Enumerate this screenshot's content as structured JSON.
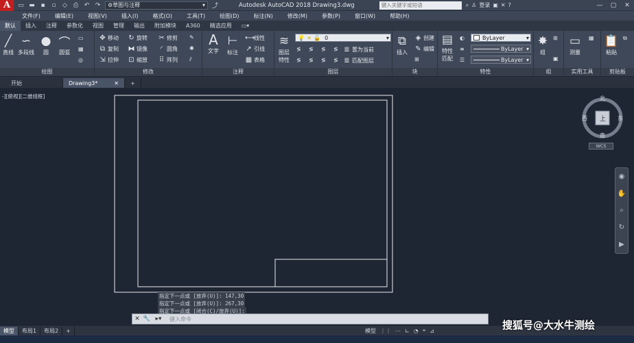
{
  "app": {
    "logo": "A",
    "workspace": "草图与注释",
    "title": "Autodesk AutoCAD 2018    Drawing3.dwg",
    "search_placeholder": "键入关键字或短语",
    "login": "登录"
  },
  "menu": [
    "文件(F)",
    "编辑(E)",
    "视图(V)",
    "插入(I)",
    "格式(O)",
    "工具(T)",
    "绘图(D)",
    "标注(N)",
    "修改(M)",
    "参数(P)",
    "窗口(W)",
    "帮助(H)"
  ],
  "ribbon_tabs": [
    "默认",
    "插入",
    "注释",
    "参数化",
    "视图",
    "管理",
    "输出",
    "附加模块",
    "A360",
    "精选应用"
  ],
  "ribbon": {
    "draw": {
      "title": "绘图",
      "line": "直线",
      "polyline": "多段线",
      "circle": "圆",
      "arc": "圆弧"
    },
    "modify": {
      "title": "修改",
      "move": "移动",
      "rotate": "旋转",
      "trim": "修剪",
      "copy": "复制",
      "mirror": "镜像",
      "fillet": "圆角",
      "stretch": "拉伸",
      "scale": "缩放",
      "array": "阵列"
    },
    "annotation": {
      "title": "注释",
      "text": "文字",
      "dimension": "标注",
      "linear": "线性",
      "leader": "引线",
      "table": "表格"
    },
    "layers": {
      "title": "图层",
      "props_line1": "图层",
      "props_line2": "特性",
      "layer_value": "0",
      "make_current": "置为当前",
      "match": "匹配图层"
    },
    "block": {
      "title": "块",
      "insert": "插入",
      "create": "创建",
      "edit": "编辑"
    },
    "properties": {
      "title": "特性",
      "match_line1": "特性",
      "match_line2": "匹配",
      "color": "ByLayer",
      "linetype": "ByLayer",
      "lineweight": "ByLayer"
    },
    "groups": {
      "title": "组",
      "group": "组"
    },
    "utilities": {
      "title": "实用工具",
      "measure": "测量"
    },
    "clipboard": {
      "title": "剪贴板",
      "paste": "粘贴"
    }
  },
  "doc_tabs": [
    "开始",
    "Drawing3*"
  ],
  "viewport_label": "-][俯视][二维线框]",
  "viewcube": {
    "north": "北",
    "south": "南",
    "east": "东",
    "west": "西",
    "top": "上",
    "wcs": "WCS"
  },
  "command_history": [
    "指定下一点或 [放弃(U)]: 147,30",
    "指定下一点或 [放弃(U)]: 267,30",
    "指定下一点或 [闭合(C)/放弃(U)]:"
  ],
  "command_placeholder": "键入命令",
  "layout_tabs": [
    "模型",
    "布局1",
    "布局2"
  ],
  "status": {
    "model": "模型"
  },
  "watermark": "搜狐号@大水牛测绘"
}
